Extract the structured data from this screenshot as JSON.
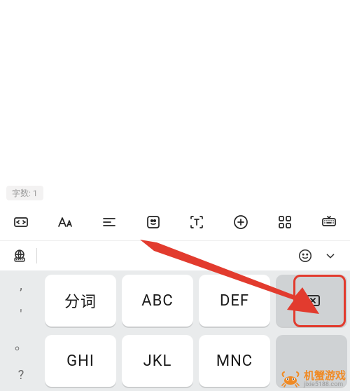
{
  "editor": {
    "wordcount_label": "字数: 1"
  },
  "toolbar": {
    "icons": [
      "expand",
      "text-size",
      "align",
      "sticker",
      "text-scan",
      "add",
      "apps",
      "keyboard-toggle"
    ]
  },
  "kbheader": {
    "icons": [
      "globe-kb",
      "smiley",
      "chevron-down"
    ]
  },
  "keys": {
    "row1": {
      "side_top": ",",
      "side_bot": "'",
      "cells": [
        "分词",
        "ABC",
        "DEF"
      ],
      "backspace_icon": "backspace"
    },
    "row2": {
      "side_top": "。",
      "side_bot": "?",
      "cells": [
        "GHI",
        "JKL",
        "MNC"
      ]
    }
  },
  "watermark": {
    "main": "机蟹游戏",
    "sub": "jixie5188.com"
  }
}
